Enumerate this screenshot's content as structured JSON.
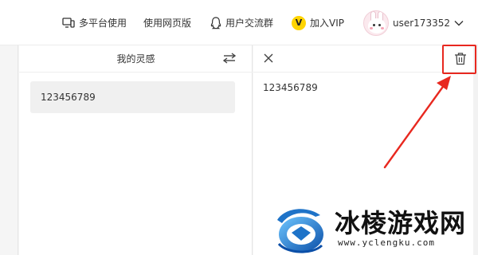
{
  "topbar": {
    "multi_platform": "多平台使用",
    "web_version": "使用网页版",
    "user_group": "用户交流群",
    "vip_badge": "V",
    "join_vip": "加入VIP",
    "username": "user173352"
  },
  "left_panel": {
    "title": "我的灵感",
    "items": [
      {
        "text": "123456789"
      }
    ]
  },
  "right_panel": {
    "content": "123456789"
  },
  "annotation": {
    "highlight_color": "#e8281f"
  },
  "watermark": {
    "title": "冰棱游戏网",
    "url": "www.yclengku.com"
  },
  "icons": [
    "devices-icon",
    "qq-icon",
    "vip-icon",
    "avatar",
    "chevron-down-icon",
    "swap-icon",
    "close-icon",
    "trash-icon"
  ],
  "colors": {
    "accent_red": "#e8281f",
    "vip_yellow": "#ffd400",
    "logo_blue": "#1e73c8"
  }
}
